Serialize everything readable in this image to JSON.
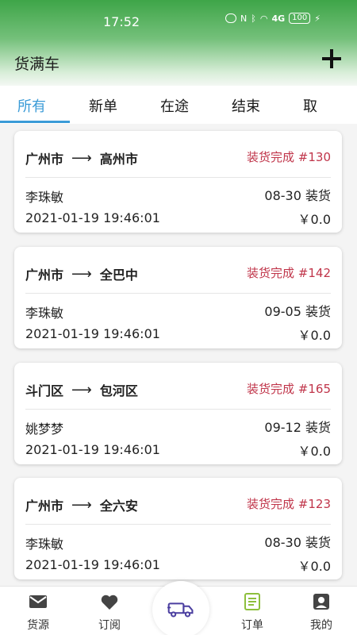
{
  "status_bar": {
    "time": "17:52",
    "network": "4G",
    "battery": "100"
  },
  "header": {
    "title": "货满车",
    "add_icon": "plus-icon"
  },
  "tabs": [
    {
      "label": "所有",
      "active": true
    },
    {
      "label": "新单",
      "active": false
    },
    {
      "label": "在途",
      "active": false
    },
    {
      "label": "结束",
      "active": false
    },
    {
      "label": "取",
      "active": false
    }
  ],
  "orders": [
    {
      "from": "广州市",
      "to": "高州市",
      "status": "装货完成 #130",
      "name": "李珠敏",
      "load": "08-30 装货",
      "time": "2021-01-19 19:46:01",
      "price": "￥0.0"
    },
    {
      "from": "广州市",
      "to": "全巴中",
      "status": "装货完成 #142",
      "name": "李珠敏",
      "load": "09-05 装货",
      "time": "2021-01-19 19:46:01",
      "price": "￥0.0"
    },
    {
      "from": "斗门区",
      "to": "包河区",
      "status": "装货完成 #165",
      "name": "姚梦梦",
      "load": "09-12 装货",
      "time": "2021-01-19 19:46:01",
      "price": "￥0.0"
    },
    {
      "from": "广州市",
      "to": "全六安",
      "status": "装货完成 #123",
      "name": "李珠敏",
      "load": "08-30 装货",
      "time": "2021-01-19 19:46:01",
      "price": "￥0.0"
    }
  ],
  "route_arrow": "⟶",
  "bottom_nav": [
    {
      "label": "货源",
      "icon": "mail-icon",
      "active": false
    },
    {
      "label": "订阅",
      "icon": "heart-icon",
      "active": false
    },
    {
      "label": "",
      "icon": "truck-icon",
      "active": false
    },
    {
      "label": "订单",
      "icon": "document-icon",
      "active": true
    },
    {
      "label": "我的",
      "icon": "profile-icon",
      "active": false
    }
  ],
  "colors": {
    "accent": "#3a9bd7",
    "status_red": "#c0354a",
    "nav_active": "#8dbf3c",
    "header_green": "#3ea548"
  }
}
